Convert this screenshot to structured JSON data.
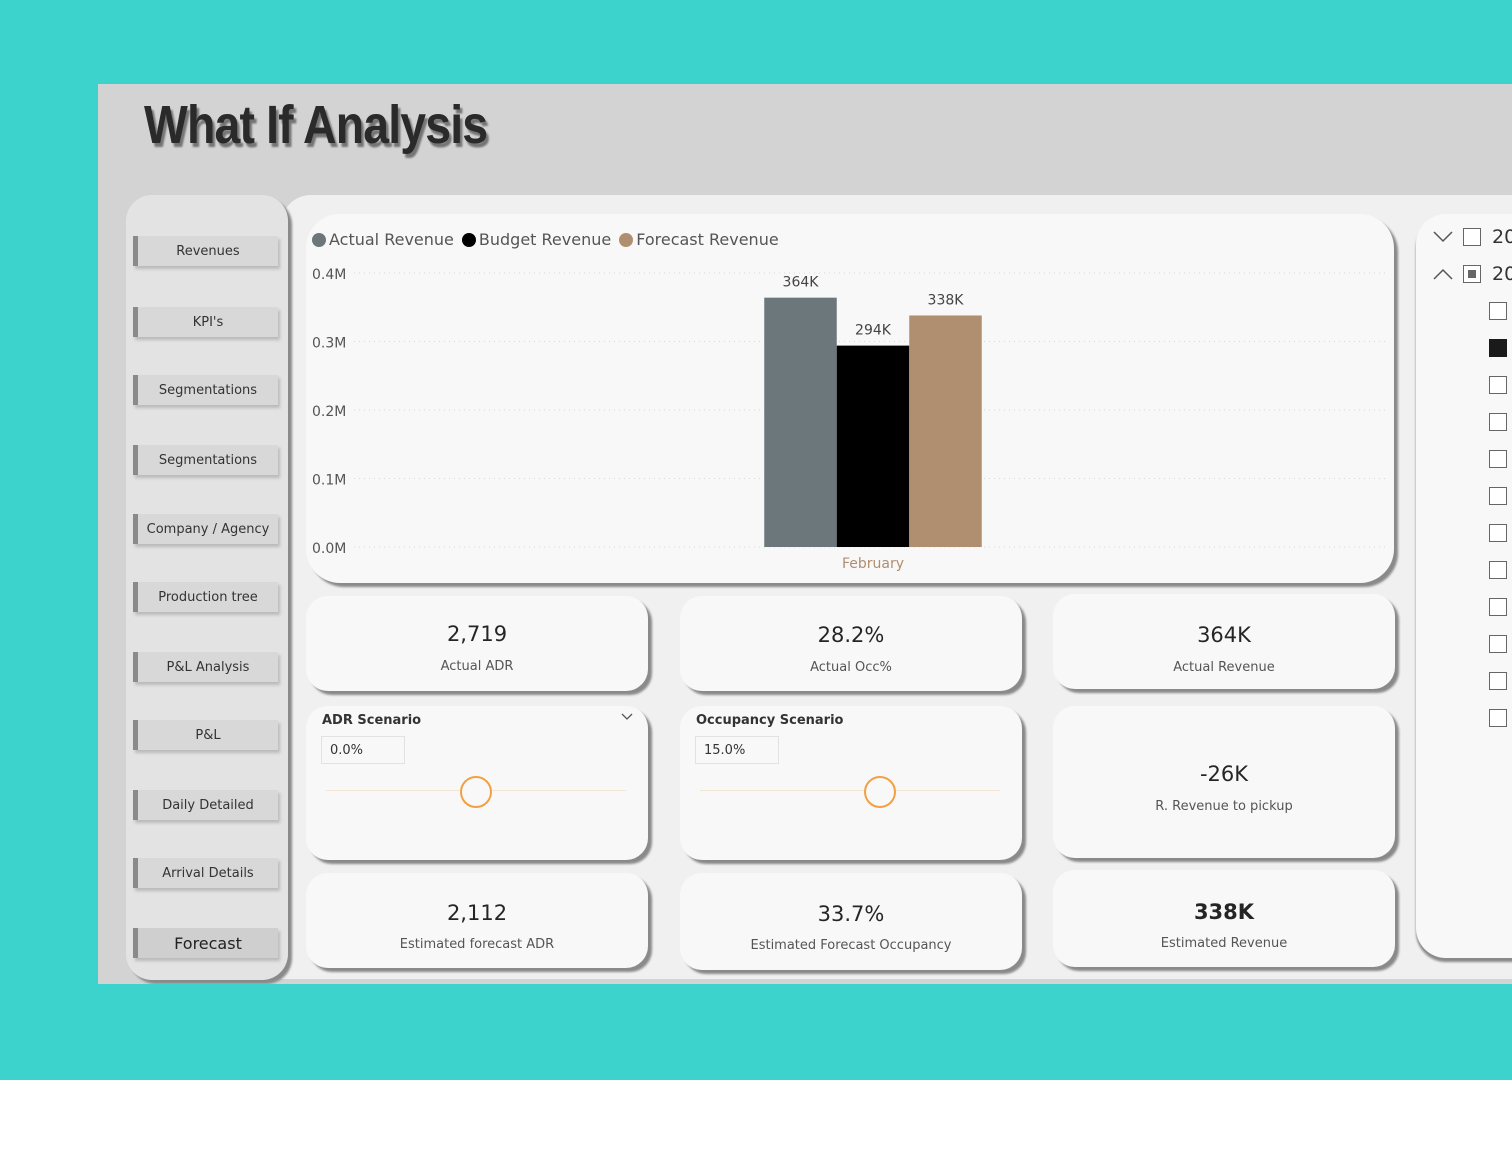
{
  "page": {
    "title": "What If Analysis"
  },
  "nav": {
    "items": [
      {
        "label": "Revenues"
      },
      {
        "label": "KPI's"
      },
      {
        "label": "Segmentations"
      },
      {
        "label": "Segmentations"
      },
      {
        "label": "Company / Agency"
      },
      {
        "label": "Production tree"
      },
      {
        "label": "P&L Analysis"
      },
      {
        "label": "P&L"
      },
      {
        "label": "Daily Detailed"
      },
      {
        "label": "Arrival Details"
      },
      {
        "label": "Forecast"
      }
    ]
  },
  "chart_data": {
    "type": "bar",
    "categories": [
      "February"
    ],
    "series": [
      {
        "name": "Actual Revenue",
        "values": [
          364000
        ],
        "label": "364K",
        "color": "#6b777b"
      },
      {
        "name": "Budget Revenue",
        "values": [
          294000
        ],
        "label": "294K",
        "color": "#000000"
      },
      {
        "name": "Forecast Revenue",
        "values": [
          338000
        ],
        "label": "338K",
        "color": "#b08e70"
      }
    ],
    "yticks": [
      "0.0M",
      "0.1M",
      "0.2M",
      "0.3M",
      "0.4M"
    ],
    "ylim": [
      0,
      400000
    ],
    "legend": "top-left",
    "grid": true
  },
  "kpis": {
    "actual_adr": {
      "value": "2,719",
      "label": "Actual ADR"
    },
    "actual_occ": {
      "value": "28.2%",
      "label": "Actual Occ%"
    },
    "actual_revenue": {
      "value": "364K",
      "label": "Actual Revenue"
    },
    "revenue_pickup": {
      "value": "-26K",
      "label": "R. Revenue to pickup"
    },
    "est_adr": {
      "value": "2,112",
      "label": "Estimated forecast ADR"
    },
    "est_occ": {
      "value": "33.7%",
      "label": "Estimated Forecast Occupancy"
    },
    "est_revenue": {
      "value": "338K",
      "label": "Estimated Revenue"
    }
  },
  "scenarios": {
    "adr": {
      "title": "ADR Scenario",
      "value": "0.0%",
      "level": 0.5
    },
    "occ": {
      "title": "Occupancy Scenario",
      "value": "15.0%",
      "level": 0.6
    }
  },
  "slicer": {
    "years": [
      {
        "label": "20",
        "state": "collapsed",
        "checked": false
      },
      {
        "label": "20",
        "state": "expanded",
        "checked": "partial"
      }
    ],
    "months": [
      false,
      true,
      false,
      false,
      false,
      false,
      false,
      false,
      false,
      false,
      false,
      false
    ]
  }
}
